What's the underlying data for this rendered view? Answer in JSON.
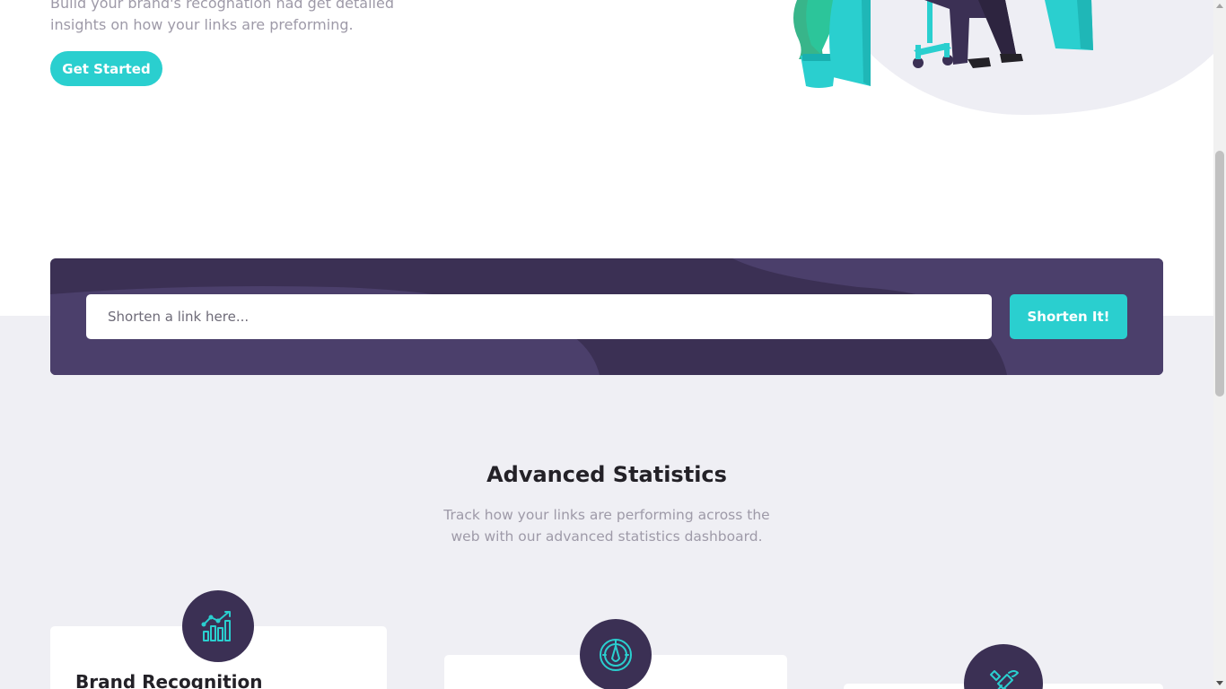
{
  "hero": {
    "description": "Build your brand's recognation nad get detailed insights on how your links are preforming.",
    "cta_label": "Get Started"
  },
  "shorten": {
    "placeholder": "Shorten a link here...",
    "button_label": "Shorten It!"
  },
  "stats": {
    "title": "Advanced Statistics",
    "subtitle": "Track how your links are performing across the web with our advanced statistics dashboard.",
    "cards": [
      {
        "title": "Brand Recognition",
        "icon": "brand-recognition-icon"
      },
      {
        "title": "",
        "icon": "detailed-records-icon"
      },
      {
        "title": "",
        "icon": "fully-customizable-icon"
      }
    ]
  },
  "colors": {
    "cyan": "#2acfcf",
    "dark_violet": "#3b3054",
    "gray_bg": "#efeff4",
    "text_gray": "#9e9aa8",
    "heading": "#232127"
  }
}
